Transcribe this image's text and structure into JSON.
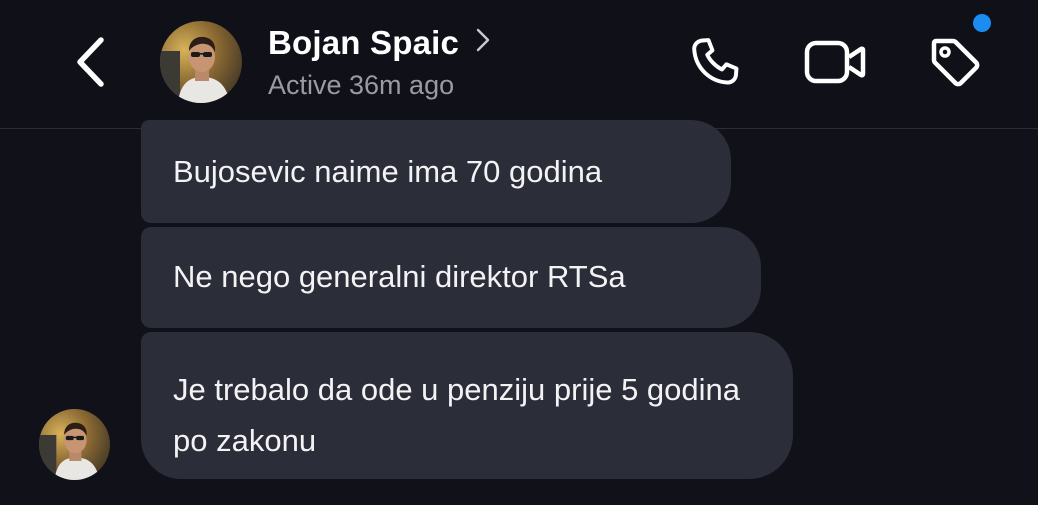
{
  "header": {
    "contact_name": "Bojan Spaic",
    "status": "Active 36m ago",
    "icons": {
      "back": "back-chevron-icon",
      "name_chevron": "chevron-right-icon",
      "call": "phone-icon",
      "video": "video-camera-icon",
      "tag": "tag-icon"
    },
    "notification_dot_color": "#1b8cf2"
  },
  "messages": [
    {
      "text": "Bujosevic naime ima 70 godina"
    },
    {
      "text": "Ne nego generalni direktor RTSa"
    },
    {
      "text": "Je trebalo da ode u penziju prije 5 godina po zakonu"
    }
  ],
  "colors": {
    "background": "#101119",
    "bubble": "#2b2d38",
    "status_text": "#9a9aa4"
  }
}
